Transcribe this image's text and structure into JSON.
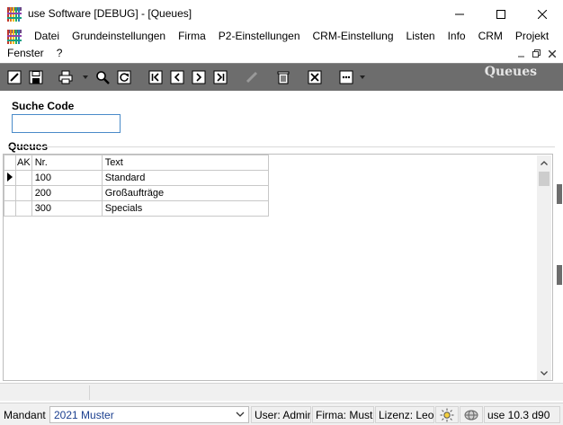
{
  "window": {
    "title": "use Software [DEBUG] - [Queues]"
  },
  "menu": {
    "items_row1": [
      "Datei",
      "Grundeinstellungen",
      "Firma",
      "P2-Einstellungen",
      "CRM-Einstellung",
      "Listen",
      "Info",
      "CRM",
      "Projekt"
    ],
    "items_row2": [
      "Fenster",
      "?"
    ]
  },
  "toolbar": {
    "title": "Queues"
  },
  "search": {
    "label": "Suche Code",
    "value": ""
  },
  "queues": {
    "label": "Queues",
    "columns": [
      "",
      "AK",
      "Nr.",
      "Text"
    ],
    "rows": [
      {
        "ak": "",
        "nr": "100",
        "text": "Standard"
      },
      {
        "ak": "",
        "nr": "200",
        "text": "Großaufträge"
      },
      {
        "ak": "",
        "nr": "300",
        "text": "Specials"
      }
    ]
  },
  "status": {
    "mandant_label": "Mandant",
    "mandant_value": "2021 Muster",
    "user": "User: Admini",
    "firma": "Firma: Muste",
    "lizenz": "Lizenz: Leoni",
    "version": "use 10.3 d90"
  }
}
